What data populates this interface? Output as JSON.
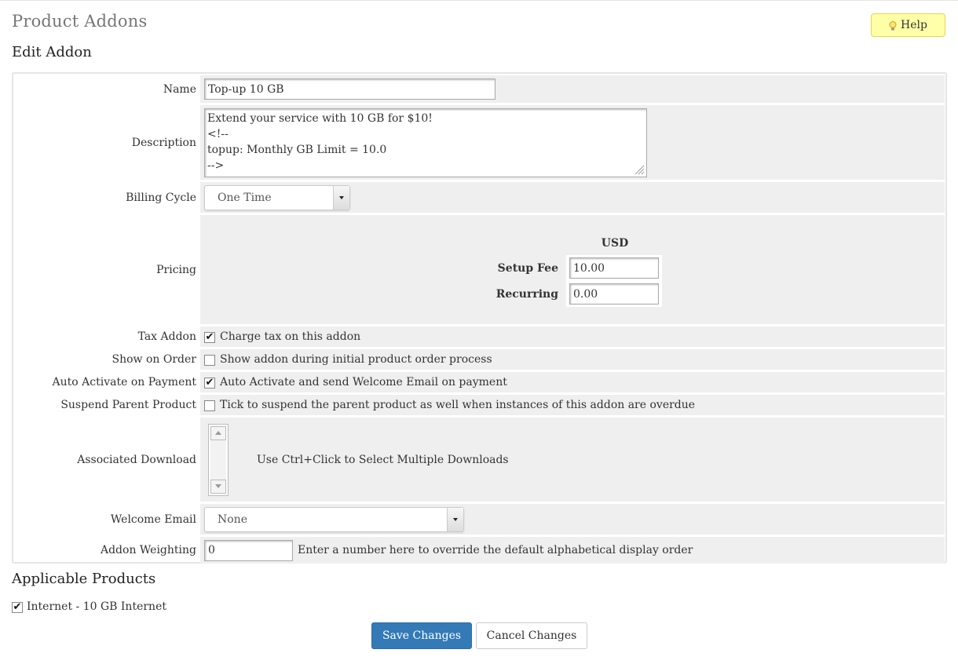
{
  "header": {
    "title": "Product Addons",
    "help_label": "Help"
  },
  "sections": {
    "edit_addon": "Edit Addon",
    "applicable_products": "Applicable Products"
  },
  "form": {
    "name": {
      "label": "Name",
      "value": "Top-up 10 GB"
    },
    "description": {
      "label": "Description",
      "value": "Extend your service with 10 GB for $10!\n<!--\ntopup: Monthly GB Limit = 10.0\n-->"
    },
    "billing_cycle": {
      "label": "Billing Cycle",
      "value": "One Time"
    },
    "pricing": {
      "label": "Pricing",
      "currency": "USD",
      "setup_fee_label": "Setup Fee",
      "setup_fee": "10.00",
      "recurring_label": "Recurring",
      "recurring": "0.00"
    },
    "tax_addon": {
      "label": "Tax Addon",
      "text": "Charge tax on this addon",
      "checked": true
    },
    "show_on_order": {
      "label": "Show on Order",
      "text": "Show addon during initial product order process",
      "checked": false
    },
    "auto_activate": {
      "label": "Auto Activate on Payment",
      "text": "Auto Activate and send Welcome Email on payment",
      "checked": true
    },
    "suspend_parent": {
      "label": "Suspend Parent Product",
      "text": "Tick to suspend the parent product as well when instances of this addon are overdue",
      "checked": false
    },
    "associated_download": {
      "label": "Associated Download",
      "hint": "Use Ctrl+Click to Select Multiple Downloads"
    },
    "welcome_email": {
      "label": "Welcome Email",
      "value": "None"
    },
    "addon_weighting": {
      "label": "Addon Weighting",
      "value": "0",
      "hint": "Enter a number here to override the default alphabetical display order"
    }
  },
  "applicable_products": [
    {
      "label": "Internet - 10 GB Internet",
      "checked": true
    }
  ],
  "buttons": {
    "save": "Save Changes",
    "cancel": "Cancel Changes"
  },
  "colors": {
    "save_button": "#337ab7",
    "help_button": "#ffffa8",
    "row_background": "#efefef"
  },
  "icons": {
    "help": "lightbulb-icon",
    "check": "checkmark-icon"
  }
}
